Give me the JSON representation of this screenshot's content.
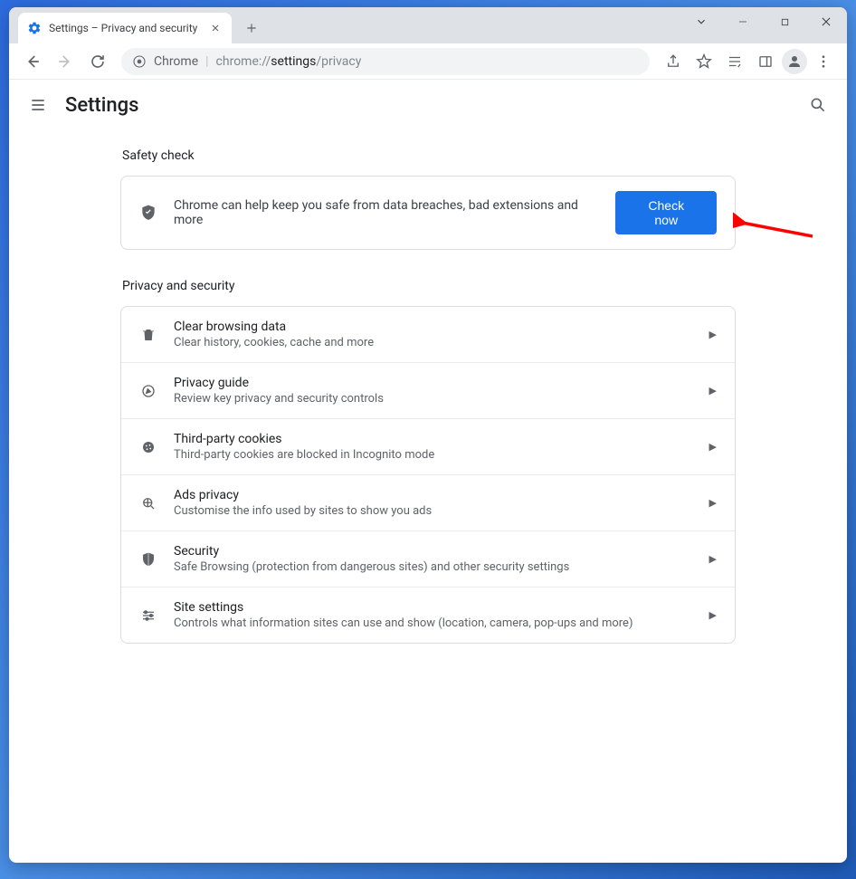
{
  "window": {
    "tab_title": "Settings – Privacy and security"
  },
  "omnibox": {
    "chrome_label": "Chrome",
    "url_prefix": "chrome://",
    "url_main": "settings",
    "url_suffix": "/privacy"
  },
  "header": {
    "title": "Settings"
  },
  "safety": {
    "section_title": "Safety check",
    "description": "Chrome can help keep you safe from data breaches, bad extensions and more",
    "button_label": "Check now"
  },
  "privacy": {
    "section_title": "Privacy and security",
    "items": [
      {
        "title": "Clear browsing data",
        "sub": "Clear history, cookies, cache and more",
        "icon": "trash-icon"
      },
      {
        "title": "Privacy guide",
        "sub": "Review key privacy and security controls",
        "icon": "compass-icon"
      },
      {
        "title": "Third-party cookies",
        "sub": "Third-party cookies are blocked in Incognito mode",
        "icon": "cookie-icon"
      },
      {
        "title": "Ads privacy",
        "sub": "Customise the info used by sites to show you ads",
        "icon": "ads-icon"
      },
      {
        "title": "Security",
        "sub": "Safe Browsing (protection from dangerous sites) and other security settings",
        "icon": "shield-icon"
      },
      {
        "title": "Site settings",
        "sub": "Controls what information sites can use and show (location, camera, pop-ups and more)",
        "icon": "tune-icon"
      }
    ]
  }
}
